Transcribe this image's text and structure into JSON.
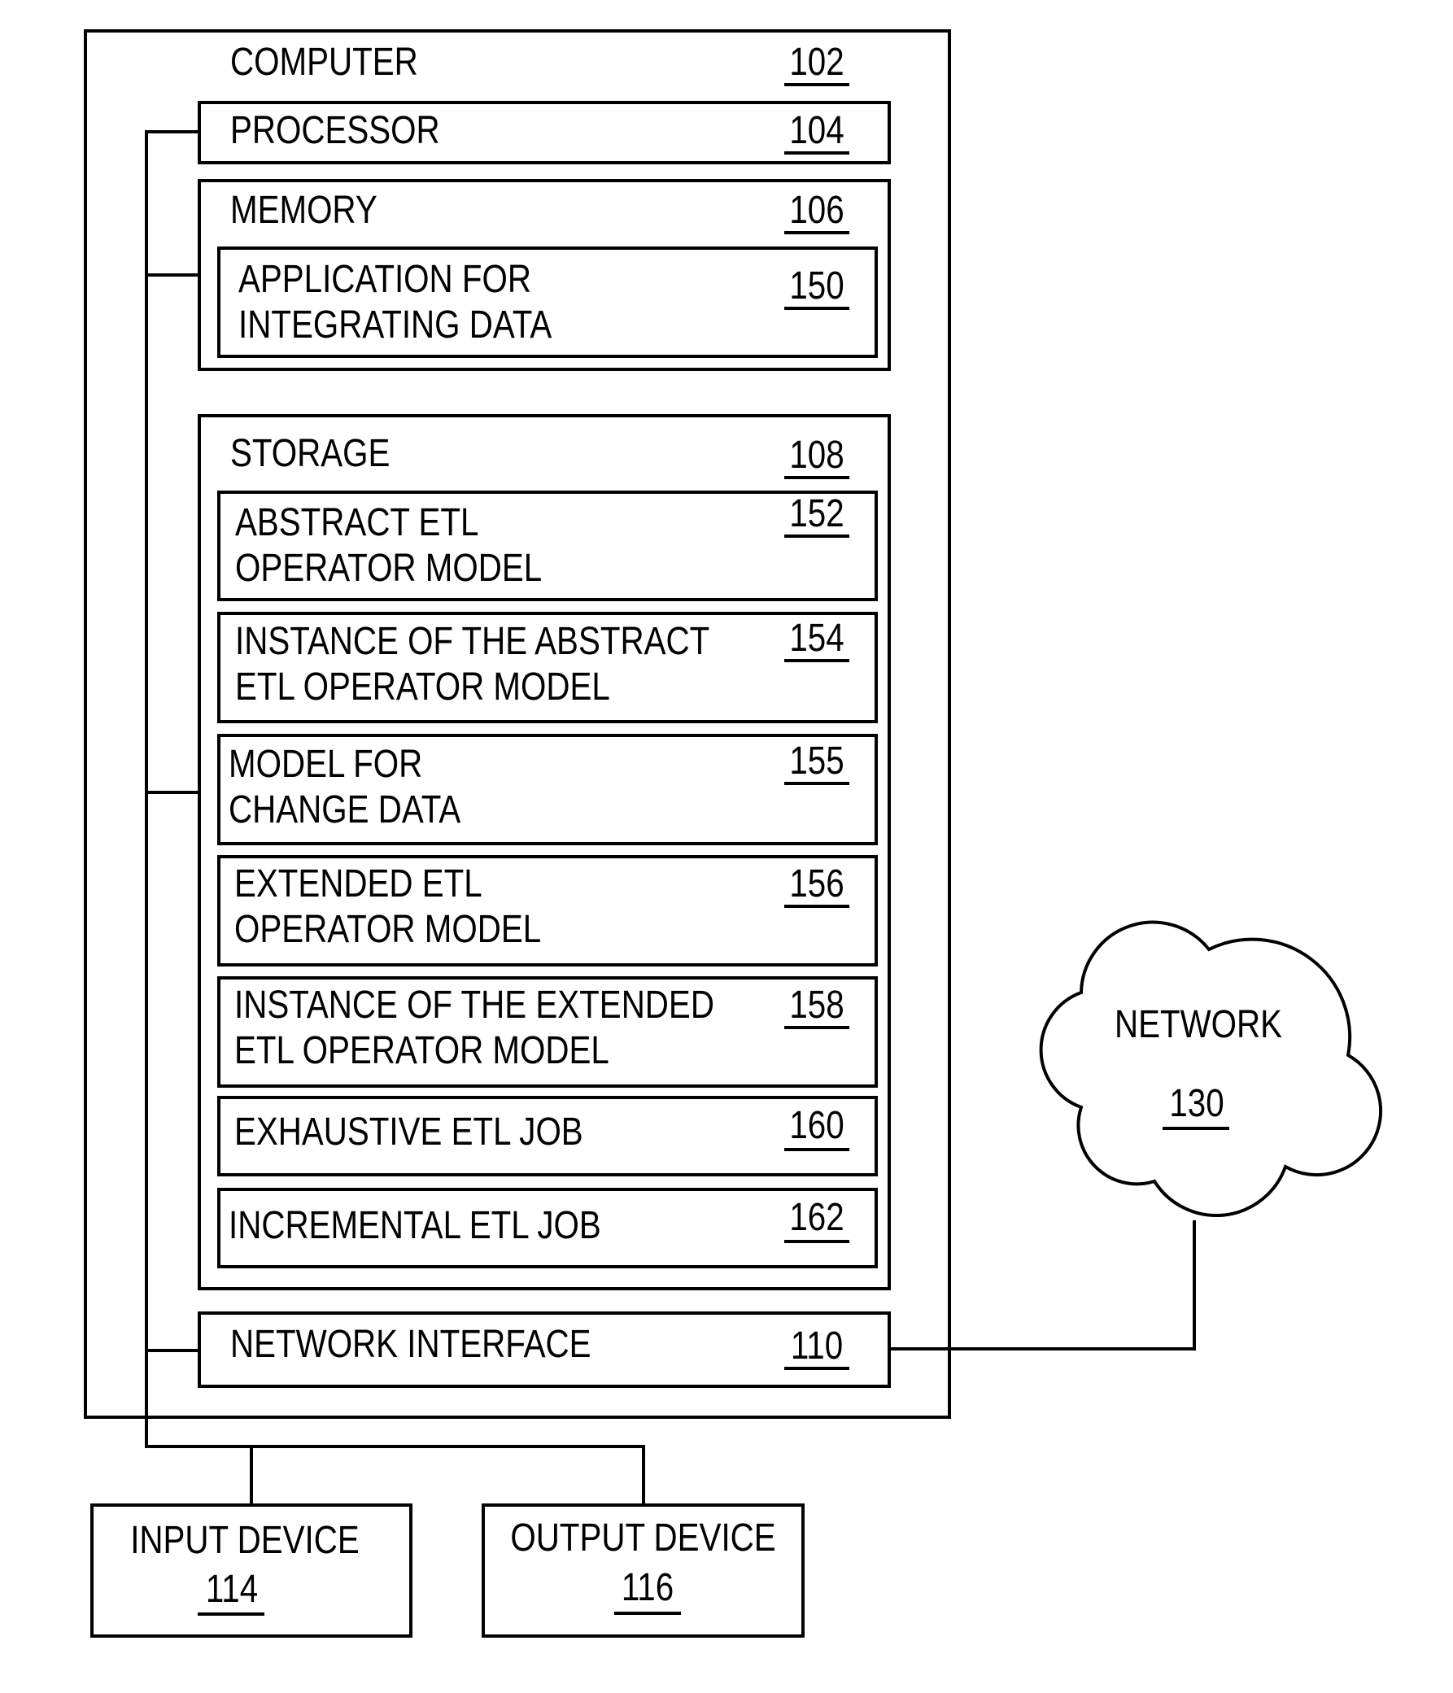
{
  "computer": {
    "label": "COMPUTER",
    "ref": "102"
  },
  "processor": {
    "label": "PROCESSOR",
    "ref": "104"
  },
  "memory": {
    "label": "MEMORY",
    "ref": "106",
    "application": {
      "line1": "APPLICATION FOR",
      "line2": "INTEGRATING DATA",
      "ref": "150"
    }
  },
  "storage": {
    "label": "STORAGE",
    "ref": "108",
    "items": [
      {
        "line1": "ABSTRACT ETL",
        "line2": "OPERATOR MODEL",
        "ref": "152"
      },
      {
        "line1": "INSTANCE OF THE ABSTRACT",
        "line2": "ETL OPERATOR MODEL",
        "ref": "154"
      },
      {
        "line1": "MODEL FOR",
        "line2": "CHANGE DATA",
        "ref": "155"
      },
      {
        "line1": "EXTENDED ETL",
        "line2": "OPERATOR MODEL",
        "ref": "156"
      },
      {
        "line1": "INSTANCE OF THE EXTENDED",
        "line2": "ETL OPERATOR MODEL",
        "ref": "158"
      },
      {
        "line1": "EXHAUSTIVE ETL JOB",
        "line2": "",
        "ref": "160"
      },
      {
        "line1": "INCREMENTAL ETL JOB",
        "line2": "",
        "ref": "162"
      }
    ]
  },
  "network_interface": {
    "label": "NETWORK INTERFACE",
    "ref": "110"
  },
  "network": {
    "label": "NETWORK",
    "ref": "130"
  },
  "input_device": {
    "label": "INPUT DEVICE",
    "ref": "114"
  },
  "output_device": {
    "label": "OUTPUT DEVICE",
    "ref": "116"
  }
}
